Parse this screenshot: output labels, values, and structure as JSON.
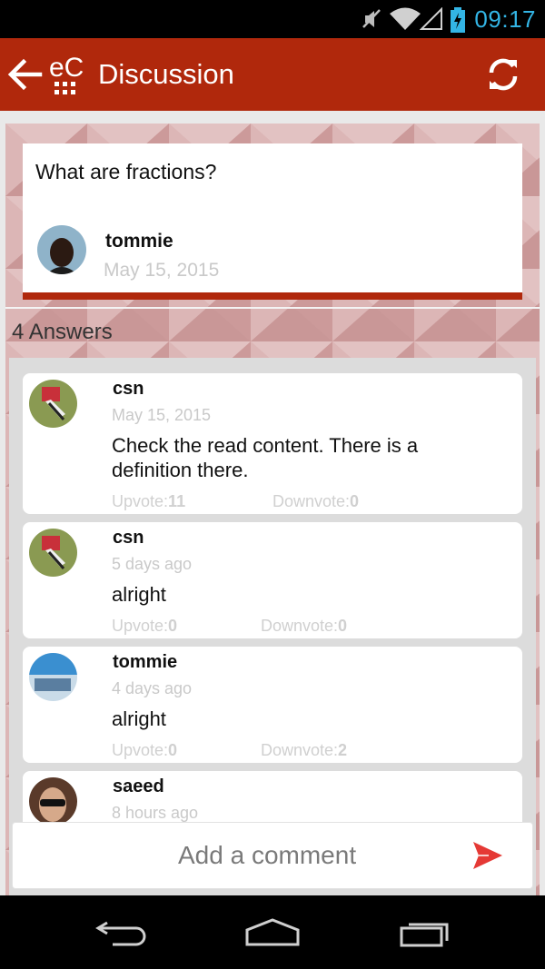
{
  "status_bar": {
    "time": "09:17",
    "icons": [
      "mute-icon",
      "wifi-icon",
      "signal-icon",
      "battery-charging-icon"
    ]
  },
  "app_bar": {
    "title": "Discussion",
    "logo_text": "eC",
    "icons": [
      "back-arrow-icon",
      "refresh-icon"
    ],
    "color": "#b0280c"
  },
  "question": {
    "text": "What are fractions?",
    "author": "tommie",
    "date": "May 15, 2015"
  },
  "answers_header": "4 Answers",
  "answers": [
    {
      "author": "csn",
      "time": "May 15, 2015",
      "text": "Check the read content. There is a definition there.",
      "upvote_label": "Upvote:",
      "upvote_count": "11",
      "downvote_label": "Downvote:",
      "downvote_count": "0"
    },
    {
      "author": "csn",
      "time": "5 days ago",
      "text": "alright",
      "upvote_label": "Upvote:",
      "upvote_count": "0",
      "downvote_label": "Downvote:",
      "downvote_count": "0"
    },
    {
      "author": "tommie",
      "time": "4 days ago",
      "text": "alright",
      "upvote_label": "Upvote:",
      "upvote_count": "0",
      "downvote_label": "Downvote:",
      "downvote_count": "2"
    },
    {
      "author": "saeed",
      "time": "8 hours ago"
    }
  ],
  "comment": {
    "placeholder": "Add a comment",
    "send_icon": "send-icon",
    "send_color": "#e53935"
  },
  "nav_bar": {
    "icons": [
      "back-icon",
      "home-icon",
      "recents-icon"
    ]
  }
}
